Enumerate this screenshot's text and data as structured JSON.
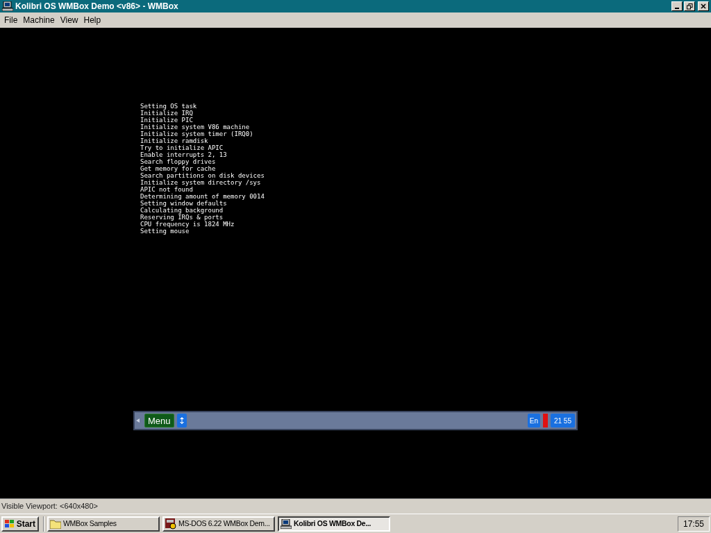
{
  "window": {
    "title": "Kolibri OS WMBox Demo <v86> - WMBox"
  },
  "menu": [
    "File",
    "Machine",
    "View",
    "Help"
  ],
  "boot_log": [
    "Setting OS task",
    "Initialize IRQ",
    "Initialize PIC",
    "Initialize system V86 machine",
    "Initialize system timer (IRQ0)",
    "Initialize ramdisk",
    "Try to initialize APIC",
    "Enable interrupts 2, 13",
    "Search floppy drives",
    "Get memory for cache",
    "Search partitions on disk devices",
    "Initialize system directory /sys",
    "APIC not found",
    "Determining amount of memory 0014",
    "Setting window defaults",
    "Calculating background",
    "Reserving IRQs & ports",
    "CPU frequency is 1824 MHz",
    "Setting mouse"
  ],
  "guest_panel": {
    "menu_label": "Menu",
    "language": "En",
    "clock": "21 55"
  },
  "status_bar": "Visible Viewport: <640x480>",
  "taskbar": {
    "start": "Start",
    "items": [
      {
        "label": "WMBox Samples",
        "kind": "folder",
        "selected": false
      },
      {
        "label": "MS-DOS 6.22 WMBox Dem...",
        "kind": "dos",
        "selected": false
      },
      {
        "label": "Kolibri OS WMBox De...",
        "kind": "computer",
        "selected": true
      }
    ],
    "clock": "17:55"
  }
}
